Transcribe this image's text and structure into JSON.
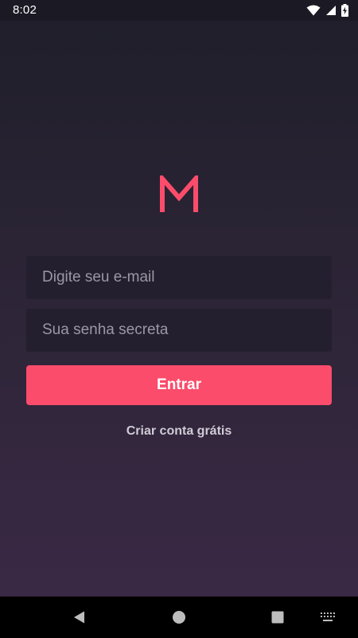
{
  "status_bar": {
    "time": "8:02",
    "icons": [
      "wifi-icon",
      "cellular-signal-icon",
      "battery-charging-icon"
    ]
  },
  "logo": {
    "letter": "M",
    "color": "#fb4c6b"
  },
  "form": {
    "email_placeholder": "Digite seu e-mail",
    "email_value": "",
    "password_placeholder": "Sua senha secreta",
    "password_value": "",
    "submit_label": "Entrar",
    "signup_label": "Criar conta grátis"
  },
  "nav_bar": {
    "icons": [
      "back-icon",
      "home-icon",
      "recents-icon",
      "keyboard-icon"
    ]
  },
  "colors": {
    "accent": "#fb4c6b",
    "background_top": "#1f1e2a",
    "background_bottom": "#3a2945",
    "field_background": "#241f2e",
    "placeholder": "#9b97a5"
  }
}
